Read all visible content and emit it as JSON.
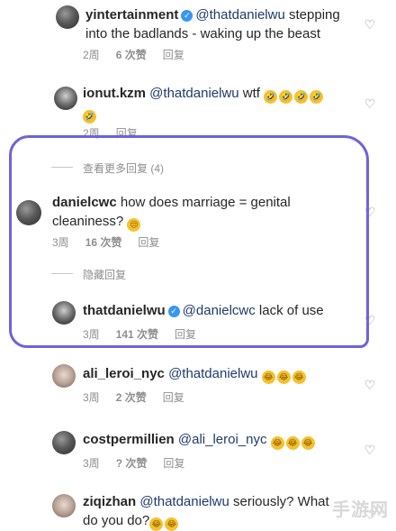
{
  "comments": [
    {
      "user": "yintertainment",
      "verified": true,
      "mention": "@thatdanielwu",
      "text": " stepping into the badlands - waking up the beast",
      "time": "2周",
      "likes": "6 次赞",
      "reply": "回复"
    },
    {
      "user": "ionut.kzm",
      "mention": "@thatdanielwu",
      "text": " wtf",
      "emojis": [
        "🤣",
        "🤣",
        "🤣",
        "🤣",
        "🤣"
      ],
      "time": "2周",
      "reply": "回复"
    },
    {
      "view_more": "查看更多回复 (4)"
    },
    {
      "user": "danielcwc",
      "text": " how does marriage = genital cleaniness?",
      "emojis": [
        "😒"
      ],
      "time": "3周",
      "likes": "16 次赞",
      "reply": "回复"
    },
    {
      "hide_replies": "隐藏回复"
    },
    {
      "user": "thatdanielwu",
      "verified": true,
      "mention": "@danielcwc",
      "text": " lack of use",
      "time": "3周",
      "likes": "141 次赞",
      "reply": "回复"
    },
    {
      "user": "ali_leroi_nyc",
      "mention": "@thatdanielwu",
      "emojis": [
        "😂",
        "😂",
        "😂"
      ],
      "time": "3周",
      "likes": "2 次赞",
      "reply": "回复"
    },
    {
      "user": "costpermillien",
      "mention": "@ali_leroi_nyc",
      "emojis": [
        "😂",
        "😂",
        "😂"
      ],
      "time": "3周",
      "likes": "? 次赞",
      "reply": "回复"
    },
    {
      "user": "ziqizhan",
      "mention": "@thatdanielwu",
      "text": " seriously? What do you do?",
      "emojis": [
        "😂",
        "😂"
      ]
    }
  ],
  "watermark": "手游网",
  "colors": {
    "highlight": "#6e63d9",
    "verified": "#3897f0",
    "meta": "#8e8e8e"
  },
  "icons": {
    "like": "heart-icon",
    "verified": "verified-badge-icon"
  }
}
